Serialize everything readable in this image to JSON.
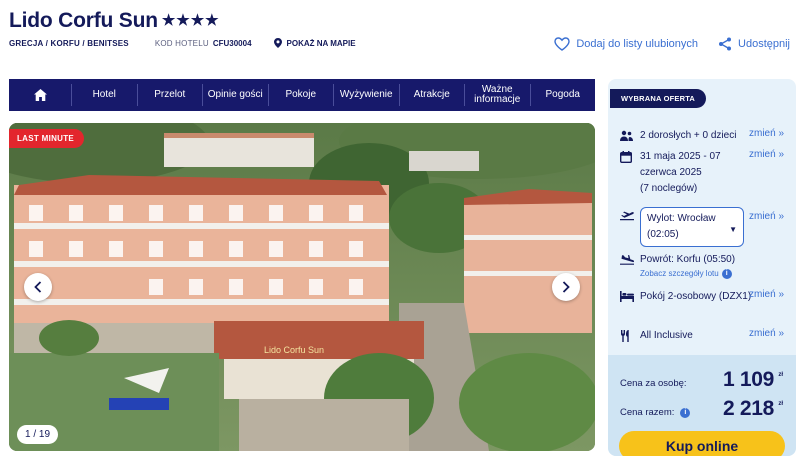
{
  "header": {
    "hotel_name": "Lido Corfu Sun",
    "stars": "★★★★",
    "breadcrumb": "GRECJA / KORFU / BENITSES",
    "code_label": "KOD HOTELU",
    "code_value": "CFU30004",
    "map_link": "POKAŻ NA MAPIE",
    "favorite_label": "Dodaj do listy ulubionych",
    "share_label": "Udostępnij"
  },
  "nav": {
    "items": [
      {
        "label": "Hotel"
      },
      {
        "label": "Przelot"
      },
      {
        "label": "Opinie gości"
      },
      {
        "label": "Pokoje"
      },
      {
        "label": "Wyżywienie"
      },
      {
        "label": "Atrakcje"
      },
      {
        "label": "Ważne informacje"
      },
      {
        "label": "Pogoda"
      }
    ]
  },
  "gallery": {
    "badge": "LAST MINUTE",
    "counter": "1 / 19",
    "sign_text": "Lido Corfu Sun"
  },
  "offer": {
    "badge": "WYBRANA OFERTA",
    "change_label": "zmień »",
    "guests": "2 dorosłych + 0 dzieci",
    "dates": "31 maja 2025 - 07 czerwca 2025",
    "nights": "(7 noclegów)",
    "departure": "Wylot: Wrocław (02:05)",
    "return": "Powrót: Korfu (05:50)",
    "flight_details": "Zobacz szczegóły lotu",
    "room": "Pokój 2-osobowy (DZX1)",
    "board": "All Inclusive",
    "price_per_person_label": "Cena za osobę:",
    "price_per_person": "1 109",
    "price_total_label": "Cena razem:",
    "price_total": "2 218",
    "currency": "zł",
    "buy_label": "Kup online"
  },
  "colors": {
    "navy": "#141a5a",
    "nav_bg": "#17196b",
    "link_blue": "#3a6fd1",
    "badge_red": "#e3262d",
    "buy_yellow": "#f7c21a",
    "panel_bg": "#e7f2fa"
  }
}
